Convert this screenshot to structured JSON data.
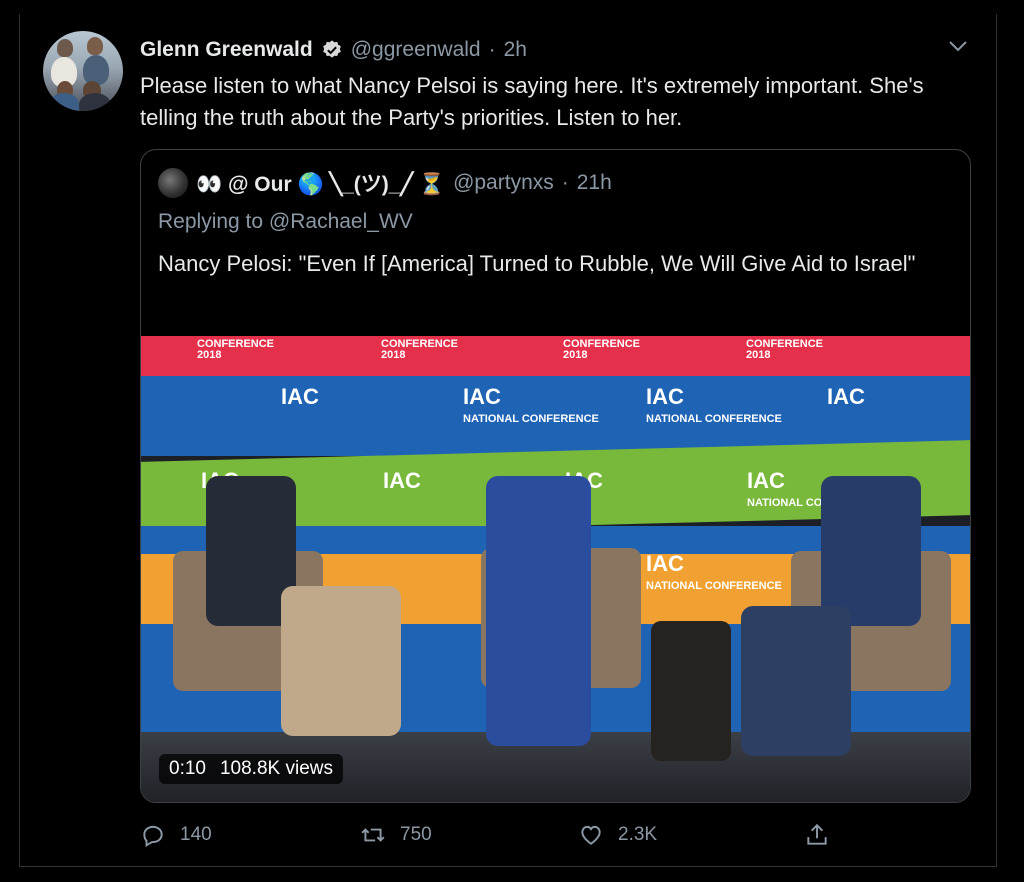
{
  "tweet": {
    "author_name": "Glenn Greenwald",
    "handle": "@ggreenwald",
    "separator": "·",
    "time": "2h",
    "text": "Please listen to what Nancy Pelsoi is saying here. It's extremely important. She's telling the truth about the Party's priorities. Listen to her.",
    "verified": true
  },
  "quoted": {
    "display_name": "👀 @ Our 🌎 ╲_(ツ)_╱ ⏳",
    "handle": "@partynxs",
    "separator": "·",
    "time": "21h",
    "replying_prefix": "Replying to",
    "replying_to": "@Rachael_WV",
    "text": "Nancy Pelosi: \"Even If [America] Turned to Rubble, We Will Give Aid to Israel\"",
    "video": {
      "banner_conference": "CONFERENCE",
      "banner_year": "2018",
      "logo_text": "IAC",
      "logo_sub": "NATIONAL CONFERENCE",
      "duration": "0:10",
      "views": "108.8K views"
    }
  },
  "actions": {
    "reply_count": "140",
    "retweet_count": "750",
    "like_count": "2.3K"
  },
  "colors": {
    "background": "#000000",
    "text": "#e7e9ea",
    "secondary": "#8b98a5",
    "verified": "#d9d9d9",
    "border": "#2f3336"
  }
}
